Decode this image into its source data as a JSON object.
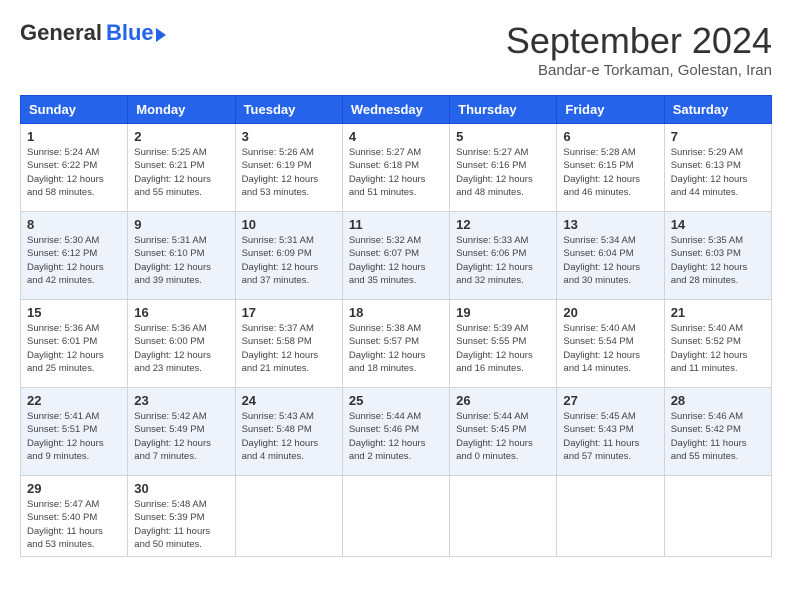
{
  "header": {
    "logo_general": "General",
    "logo_blue": "Blue",
    "month_title": "September 2024",
    "location": "Bandar-e Torkaman, Golestan, Iran"
  },
  "weekdays": [
    "Sunday",
    "Monday",
    "Tuesday",
    "Wednesday",
    "Thursday",
    "Friday",
    "Saturday"
  ],
  "weeks": [
    [
      {
        "day": "1",
        "sunrise": "Sunrise: 5:24 AM",
        "sunset": "Sunset: 6:22 PM",
        "daylight": "Daylight: 12 hours and 58 minutes."
      },
      {
        "day": "2",
        "sunrise": "Sunrise: 5:25 AM",
        "sunset": "Sunset: 6:21 PM",
        "daylight": "Daylight: 12 hours and 55 minutes."
      },
      {
        "day": "3",
        "sunrise": "Sunrise: 5:26 AM",
        "sunset": "Sunset: 6:19 PM",
        "daylight": "Daylight: 12 hours and 53 minutes."
      },
      {
        "day": "4",
        "sunrise": "Sunrise: 5:27 AM",
        "sunset": "Sunset: 6:18 PM",
        "daylight": "Daylight: 12 hours and 51 minutes."
      },
      {
        "day": "5",
        "sunrise": "Sunrise: 5:27 AM",
        "sunset": "Sunset: 6:16 PM",
        "daylight": "Daylight: 12 hours and 48 minutes."
      },
      {
        "day": "6",
        "sunrise": "Sunrise: 5:28 AM",
        "sunset": "Sunset: 6:15 PM",
        "daylight": "Daylight: 12 hours and 46 minutes."
      },
      {
        "day": "7",
        "sunrise": "Sunrise: 5:29 AM",
        "sunset": "Sunset: 6:13 PM",
        "daylight": "Daylight: 12 hours and 44 minutes."
      }
    ],
    [
      {
        "day": "8",
        "sunrise": "Sunrise: 5:30 AM",
        "sunset": "Sunset: 6:12 PM",
        "daylight": "Daylight: 12 hours and 42 minutes."
      },
      {
        "day": "9",
        "sunrise": "Sunrise: 5:31 AM",
        "sunset": "Sunset: 6:10 PM",
        "daylight": "Daylight: 12 hours and 39 minutes."
      },
      {
        "day": "10",
        "sunrise": "Sunrise: 5:31 AM",
        "sunset": "Sunset: 6:09 PM",
        "daylight": "Daylight: 12 hours and 37 minutes."
      },
      {
        "day": "11",
        "sunrise": "Sunrise: 5:32 AM",
        "sunset": "Sunset: 6:07 PM",
        "daylight": "Daylight: 12 hours and 35 minutes."
      },
      {
        "day": "12",
        "sunrise": "Sunrise: 5:33 AM",
        "sunset": "Sunset: 6:06 PM",
        "daylight": "Daylight: 12 hours and 32 minutes."
      },
      {
        "day": "13",
        "sunrise": "Sunrise: 5:34 AM",
        "sunset": "Sunset: 6:04 PM",
        "daylight": "Daylight: 12 hours and 30 minutes."
      },
      {
        "day": "14",
        "sunrise": "Sunrise: 5:35 AM",
        "sunset": "Sunset: 6:03 PM",
        "daylight": "Daylight: 12 hours and 28 minutes."
      }
    ],
    [
      {
        "day": "15",
        "sunrise": "Sunrise: 5:36 AM",
        "sunset": "Sunset: 6:01 PM",
        "daylight": "Daylight: 12 hours and 25 minutes."
      },
      {
        "day": "16",
        "sunrise": "Sunrise: 5:36 AM",
        "sunset": "Sunset: 6:00 PM",
        "daylight": "Daylight: 12 hours and 23 minutes."
      },
      {
        "day": "17",
        "sunrise": "Sunrise: 5:37 AM",
        "sunset": "Sunset: 5:58 PM",
        "daylight": "Daylight: 12 hours and 21 minutes."
      },
      {
        "day": "18",
        "sunrise": "Sunrise: 5:38 AM",
        "sunset": "Sunset: 5:57 PM",
        "daylight": "Daylight: 12 hours and 18 minutes."
      },
      {
        "day": "19",
        "sunrise": "Sunrise: 5:39 AM",
        "sunset": "Sunset: 5:55 PM",
        "daylight": "Daylight: 12 hours and 16 minutes."
      },
      {
        "day": "20",
        "sunrise": "Sunrise: 5:40 AM",
        "sunset": "Sunset: 5:54 PM",
        "daylight": "Daylight: 12 hours and 14 minutes."
      },
      {
        "day": "21",
        "sunrise": "Sunrise: 5:40 AM",
        "sunset": "Sunset: 5:52 PM",
        "daylight": "Daylight: 12 hours and 11 minutes."
      }
    ],
    [
      {
        "day": "22",
        "sunrise": "Sunrise: 5:41 AM",
        "sunset": "Sunset: 5:51 PM",
        "daylight": "Daylight: 12 hours and 9 minutes."
      },
      {
        "day": "23",
        "sunrise": "Sunrise: 5:42 AM",
        "sunset": "Sunset: 5:49 PM",
        "daylight": "Daylight: 12 hours and 7 minutes."
      },
      {
        "day": "24",
        "sunrise": "Sunrise: 5:43 AM",
        "sunset": "Sunset: 5:48 PM",
        "daylight": "Daylight: 12 hours and 4 minutes."
      },
      {
        "day": "25",
        "sunrise": "Sunrise: 5:44 AM",
        "sunset": "Sunset: 5:46 PM",
        "daylight": "Daylight: 12 hours and 2 minutes."
      },
      {
        "day": "26",
        "sunrise": "Sunrise: 5:44 AM",
        "sunset": "Sunset: 5:45 PM",
        "daylight": "Daylight: 12 hours and 0 minutes."
      },
      {
        "day": "27",
        "sunrise": "Sunrise: 5:45 AM",
        "sunset": "Sunset: 5:43 PM",
        "daylight": "Daylight: 11 hours and 57 minutes."
      },
      {
        "day": "28",
        "sunrise": "Sunrise: 5:46 AM",
        "sunset": "Sunset: 5:42 PM",
        "daylight": "Daylight: 11 hours and 55 minutes."
      }
    ],
    [
      {
        "day": "29",
        "sunrise": "Sunrise: 5:47 AM",
        "sunset": "Sunset: 5:40 PM",
        "daylight": "Daylight: 11 hours and 53 minutes."
      },
      {
        "day": "30",
        "sunrise": "Sunrise: 5:48 AM",
        "sunset": "Sunset: 5:39 PM",
        "daylight": "Daylight: 11 hours and 50 minutes."
      },
      null,
      null,
      null,
      null,
      null
    ]
  ]
}
